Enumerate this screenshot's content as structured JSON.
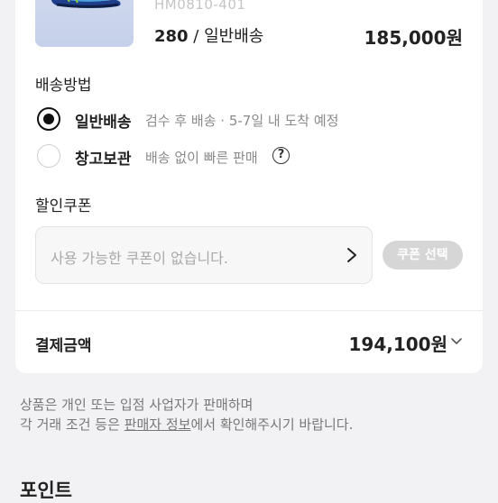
{
  "product": {
    "model_code": "HM0810-401",
    "size": "280",
    "shipping_type": "일반배송",
    "price": "185,000원"
  },
  "shipping": {
    "title": "배송방법",
    "options": [
      {
        "label": "일반배송",
        "desc": "검수 후 배송 · 5-7일 내 도착 예정",
        "selected": true
      },
      {
        "label": "창고보관",
        "desc": "배송 없이 빠른 판매",
        "selected": false
      }
    ]
  },
  "coupon": {
    "title": "할인쿠폰",
    "placeholder": "사용 가능한 쿠폰이 없습니다.",
    "button_label": "쿠폰 선택"
  },
  "payment": {
    "label": "결제금액",
    "amount": "194,100원"
  },
  "notice": {
    "line1": "상품은 개인 또는 입점 사업자가 판매하며",
    "line2_pre": "각 거래 조건 등은 ",
    "line2_link": "판매자 정보",
    "line2_post": "에서 확인해주시기 바랍니다."
  },
  "points": {
    "title": "포인트"
  }
}
